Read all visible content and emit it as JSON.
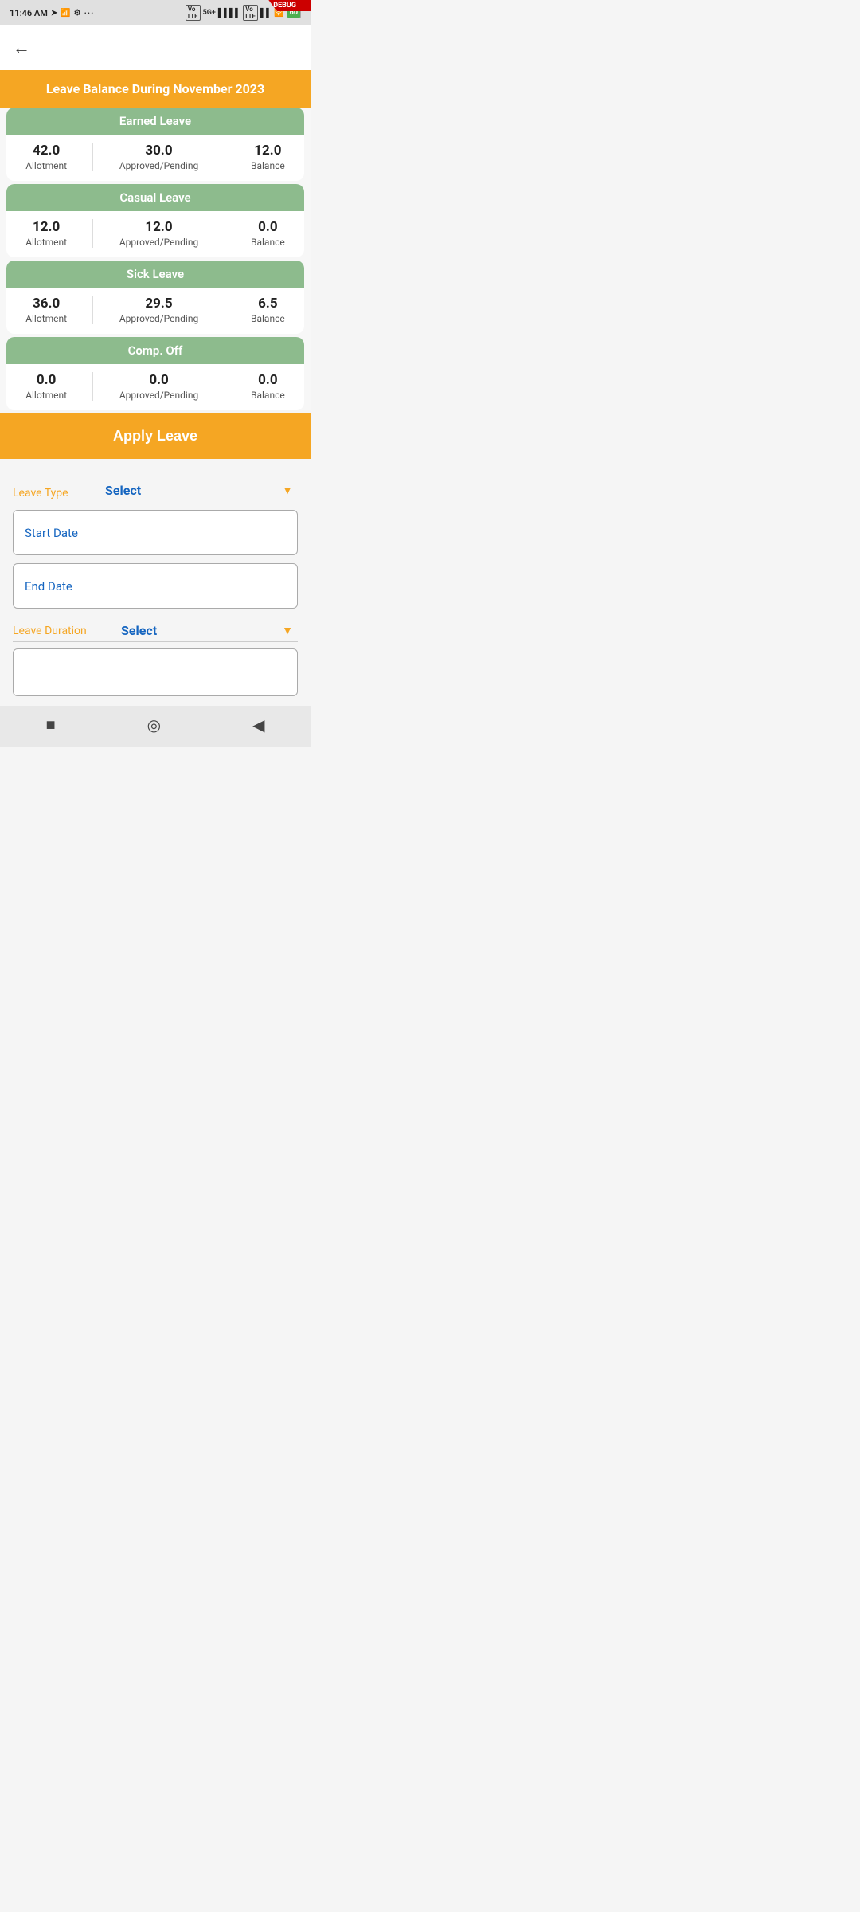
{
  "status_bar": {
    "time": "11:46 AM",
    "debug": "DEBUG"
  },
  "top_nav": {
    "back_label": "←"
  },
  "balance_section": {
    "header_title": "Leave Balance During November 2023",
    "leave_types": [
      {
        "name": "Earned Leave",
        "allotment": "42.0",
        "approved_pending": "30.0",
        "balance": "12.0",
        "allotment_label": "Allotment",
        "ap_label": "Approved/Pending",
        "balance_label": "Balance"
      },
      {
        "name": "Casual Leave",
        "allotment": "12.0",
        "approved_pending": "12.0",
        "balance": "0.0",
        "allotment_label": "Allotment",
        "ap_label": "Approved/Pending",
        "balance_label": "Balance"
      },
      {
        "name": "Sick Leave",
        "allotment": "36.0",
        "approved_pending": "29.5",
        "balance": "6.5",
        "allotment_label": "Allotment",
        "ap_label": "Approved/Pending",
        "balance_label": "Balance"
      },
      {
        "name": "Comp. Off",
        "allotment": "0.0",
        "approved_pending": "0.0",
        "balance": "0.0",
        "allotment_label": "Allotment",
        "ap_label": "Approved/Pending",
        "balance_label": "Balance"
      }
    ]
  },
  "apply_leave_btn": "Apply Leave",
  "form": {
    "leave_type_label": "Leave Type",
    "leave_type_select": "Select",
    "start_date_placeholder": "Start Date",
    "end_date_placeholder": "End Date",
    "leave_duration_label": "Leave Duration",
    "leave_duration_select": "Select"
  },
  "bottom_nav": {
    "stop_icon": "■",
    "home_icon": "◎",
    "back_icon": "◀"
  }
}
